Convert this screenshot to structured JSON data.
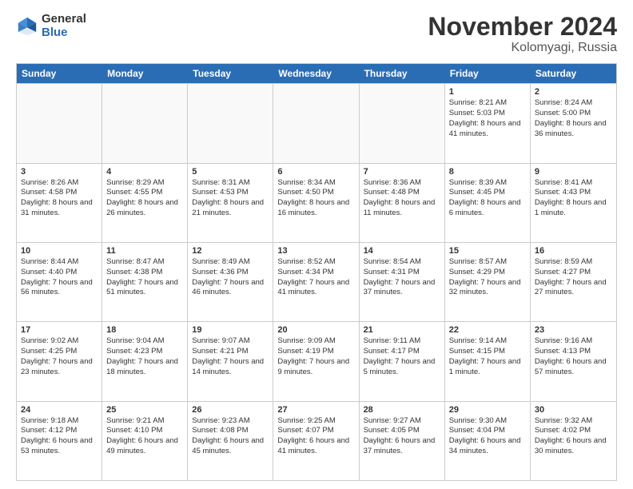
{
  "logo": {
    "general": "General",
    "blue": "Blue"
  },
  "title": {
    "month": "November 2024",
    "location": "Kolomyagi, Russia"
  },
  "header_days": [
    "Sunday",
    "Monday",
    "Tuesday",
    "Wednesday",
    "Thursday",
    "Friday",
    "Saturday"
  ],
  "weeks": [
    [
      {
        "day": "",
        "info": ""
      },
      {
        "day": "",
        "info": ""
      },
      {
        "day": "",
        "info": ""
      },
      {
        "day": "",
        "info": ""
      },
      {
        "day": "",
        "info": ""
      },
      {
        "day": "1",
        "info": "Sunrise: 8:21 AM\nSunset: 5:03 PM\nDaylight: 8 hours and 41 minutes."
      },
      {
        "day": "2",
        "info": "Sunrise: 8:24 AM\nSunset: 5:00 PM\nDaylight: 8 hours and 36 minutes."
      }
    ],
    [
      {
        "day": "3",
        "info": "Sunrise: 8:26 AM\nSunset: 4:58 PM\nDaylight: 8 hours and 31 minutes."
      },
      {
        "day": "4",
        "info": "Sunrise: 8:29 AM\nSunset: 4:55 PM\nDaylight: 8 hours and 26 minutes."
      },
      {
        "day": "5",
        "info": "Sunrise: 8:31 AM\nSunset: 4:53 PM\nDaylight: 8 hours and 21 minutes."
      },
      {
        "day": "6",
        "info": "Sunrise: 8:34 AM\nSunset: 4:50 PM\nDaylight: 8 hours and 16 minutes."
      },
      {
        "day": "7",
        "info": "Sunrise: 8:36 AM\nSunset: 4:48 PM\nDaylight: 8 hours and 11 minutes."
      },
      {
        "day": "8",
        "info": "Sunrise: 8:39 AM\nSunset: 4:45 PM\nDaylight: 8 hours and 6 minutes."
      },
      {
        "day": "9",
        "info": "Sunrise: 8:41 AM\nSunset: 4:43 PM\nDaylight: 8 hours and 1 minute."
      }
    ],
    [
      {
        "day": "10",
        "info": "Sunrise: 8:44 AM\nSunset: 4:40 PM\nDaylight: 7 hours and 56 minutes."
      },
      {
        "day": "11",
        "info": "Sunrise: 8:47 AM\nSunset: 4:38 PM\nDaylight: 7 hours and 51 minutes."
      },
      {
        "day": "12",
        "info": "Sunrise: 8:49 AM\nSunset: 4:36 PM\nDaylight: 7 hours and 46 minutes."
      },
      {
        "day": "13",
        "info": "Sunrise: 8:52 AM\nSunset: 4:34 PM\nDaylight: 7 hours and 41 minutes."
      },
      {
        "day": "14",
        "info": "Sunrise: 8:54 AM\nSunset: 4:31 PM\nDaylight: 7 hours and 37 minutes."
      },
      {
        "day": "15",
        "info": "Sunrise: 8:57 AM\nSunset: 4:29 PM\nDaylight: 7 hours and 32 minutes."
      },
      {
        "day": "16",
        "info": "Sunrise: 8:59 AM\nSunset: 4:27 PM\nDaylight: 7 hours and 27 minutes."
      }
    ],
    [
      {
        "day": "17",
        "info": "Sunrise: 9:02 AM\nSunset: 4:25 PM\nDaylight: 7 hours and 23 minutes."
      },
      {
        "day": "18",
        "info": "Sunrise: 9:04 AM\nSunset: 4:23 PM\nDaylight: 7 hours and 18 minutes."
      },
      {
        "day": "19",
        "info": "Sunrise: 9:07 AM\nSunset: 4:21 PM\nDaylight: 7 hours and 14 minutes."
      },
      {
        "day": "20",
        "info": "Sunrise: 9:09 AM\nSunset: 4:19 PM\nDaylight: 7 hours and 9 minutes."
      },
      {
        "day": "21",
        "info": "Sunrise: 9:11 AM\nSunset: 4:17 PM\nDaylight: 7 hours and 5 minutes."
      },
      {
        "day": "22",
        "info": "Sunrise: 9:14 AM\nSunset: 4:15 PM\nDaylight: 7 hours and 1 minute."
      },
      {
        "day": "23",
        "info": "Sunrise: 9:16 AM\nSunset: 4:13 PM\nDaylight: 6 hours and 57 minutes."
      }
    ],
    [
      {
        "day": "24",
        "info": "Sunrise: 9:18 AM\nSunset: 4:12 PM\nDaylight: 6 hours and 53 minutes."
      },
      {
        "day": "25",
        "info": "Sunrise: 9:21 AM\nSunset: 4:10 PM\nDaylight: 6 hours and 49 minutes."
      },
      {
        "day": "26",
        "info": "Sunrise: 9:23 AM\nSunset: 4:08 PM\nDaylight: 6 hours and 45 minutes."
      },
      {
        "day": "27",
        "info": "Sunrise: 9:25 AM\nSunset: 4:07 PM\nDaylight: 6 hours and 41 minutes."
      },
      {
        "day": "28",
        "info": "Sunrise: 9:27 AM\nSunset: 4:05 PM\nDaylight: 6 hours and 37 minutes."
      },
      {
        "day": "29",
        "info": "Sunrise: 9:30 AM\nSunset: 4:04 PM\nDaylight: 6 hours and 34 minutes."
      },
      {
        "day": "30",
        "info": "Sunrise: 9:32 AM\nSunset: 4:02 PM\nDaylight: 6 hours and 30 minutes."
      }
    ]
  ]
}
